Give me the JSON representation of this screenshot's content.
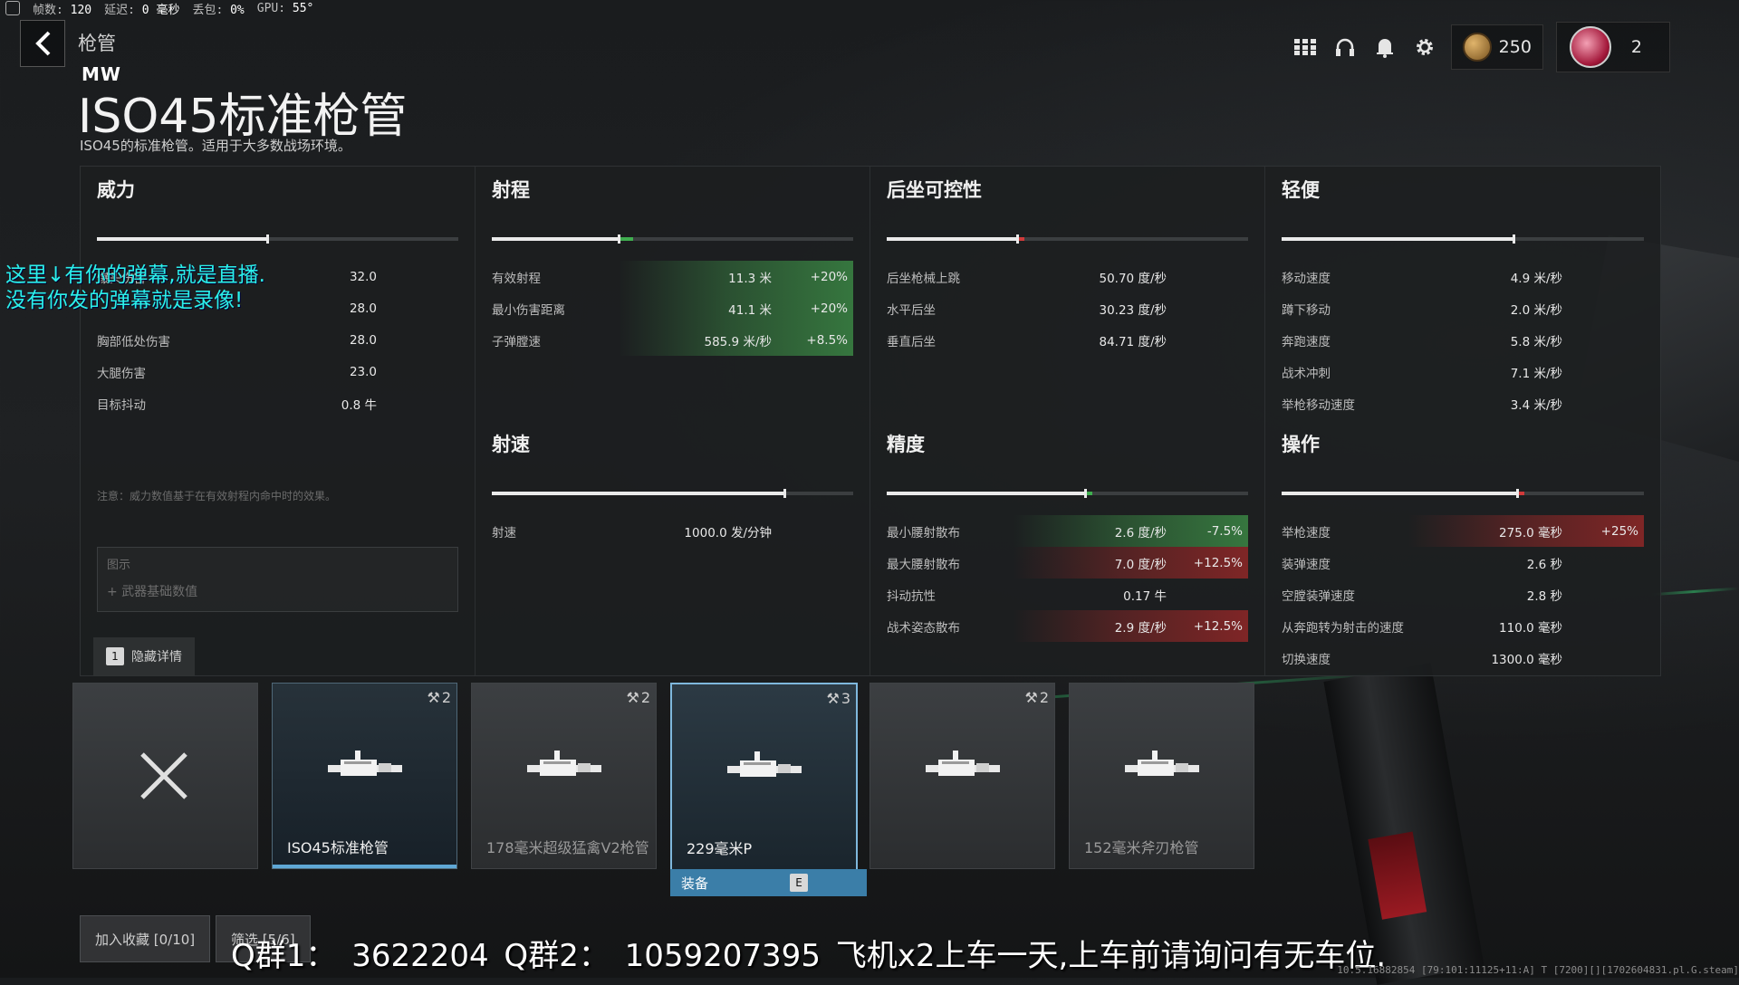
{
  "status": {
    "fps_label": "帧数:",
    "fps": "120",
    "latency_label": "延迟:",
    "latency": "0 毫秒",
    "loss_label": "丢包:",
    "loss": "0%",
    "gpu_label": "GPU:",
    "gpu": "55°"
  },
  "header": {
    "breadcrumb": "枪管",
    "brand": "MW",
    "title": "ISO45标准枪管",
    "subtitle": "ISO45的标准枪管。适用于大多数战场环境。"
  },
  "topbar": {
    "currency": "250",
    "profile_count": "2",
    "icons": [
      "grid-icon",
      "headset-icon",
      "bell-icon",
      "gear-icon"
    ]
  },
  "stats": {
    "power": {
      "title": "威力",
      "bar_fill": 0.47,
      "rows": [
        {
          "label": "爆头伤害",
          "value": "32.0"
        },
        {
          "label": "",
          "value": "28.0"
        },
        {
          "label": "胸部低处伤害",
          "value": "28.0"
        },
        {
          "label": "大腿伤害",
          "value": "23.0"
        },
        {
          "label": "目标抖动",
          "value": "0.8 牛"
        }
      ],
      "note": "注意：威力数值基于在有效射程内命中时的效果。",
      "legend_title": "图示",
      "legend_item": "+   武器基础数值",
      "hide_key": "1",
      "hide_label": "隐藏详情"
    },
    "range": {
      "title": "射程",
      "bar_fill": 0.35,
      "bar_delta": 0.04,
      "delta_color": "#3fae4f",
      "rows": [
        {
          "label": "有效射程",
          "value": "11.3 米",
          "change": "+20%",
          "state": "good"
        },
        {
          "label": "最小伤害距离",
          "value": "41.1 米",
          "change": "+20%",
          "state": "good"
        },
        {
          "label": "子弹膛速",
          "value": "585.9 米/秒",
          "change": "+8.5%",
          "state": "good"
        }
      ]
    },
    "recoil": {
      "title": "后坐可控性",
      "bar_fill": 0.36,
      "bar_delta": 0.02,
      "delta_color": "#d03a3a",
      "rows": [
        {
          "label": "后坐枪械上跳",
          "value": "50.70 度/秒"
        },
        {
          "label": "水平后坐",
          "value": "30.23 度/秒"
        },
        {
          "label": "垂直后坐",
          "value": "84.71 度/秒"
        }
      ]
    },
    "mobility": {
      "title": "轻便",
      "bar_fill": 0.64,
      "rows": [
        {
          "label": "移动速度",
          "value": "4.9 米/秒"
        },
        {
          "label": "蹲下移动",
          "value": "2.0 米/秒"
        },
        {
          "label": "奔跑速度",
          "value": "5.8 米/秒"
        },
        {
          "label": "战术冲刺",
          "value": "7.1 米/秒"
        },
        {
          "label": "举枪移动速度",
          "value": "3.4 米/秒"
        }
      ]
    },
    "fire_rate": {
      "title": "射速",
      "bar_fill": 0.81,
      "rows": [
        {
          "label": "射速",
          "value": "1000.0 发/分钟"
        }
      ]
    },
    "accuracy": {
      "title": "精度",
      "bar_fill": 0.55,
      "bar_delta": 0.02,
      "delta_color": "#3fae4f",
      "rows": [
        {
          "label": "最小腰射散布",
          "value": "2.6 度/秒",
          "change": "-7.5%",
          "state": "good"
        },
        {
          "label": "最大腰射散布",
          "value": "7.0 度/秒",
          "change": "+12.5%",
          "state": "bad"
        },
        {
          "label": "抖动抗性",
          "value": "0.17 牛"
        },
        {
          "label": "战术姿态散布",
          "value": "2.9 度/秒",
          "change": "+12.5%",
          "state": "bad"
        }
      ]
    },
    "handling": {
      "title": "操作",
      "bar_fill": 0.65,
      "bar_delta": 0.02,
      "delta_color": "#d03a3a",
      "rows": [
        {
          "label": "举枪速度",
          "value": "275.0 毫秒",
          "change": "+25%",
          "state": "bad"
        },
        {
          "label": "装弹速度",
          "value": "2.6 秒"
        },
        {
          "label": "空膛装弹速度",
          "value": "2.8 秒"
        },
        {
          "label": "从奔跑转为射击的速度",
          "value": "110.0 毫秒"
        },
        {
          "label": "切换速度",
          "value": "1300.0 毫秒"
        }
      ]
    }
  },
  "overlay_text": {
    "line1": "这里↓有你的弹幕,就是直播.",
    "line2": "没有你发的弹幕就是录像!"
  },
  "cards": [
    {
      "name": "",
      "count": "",
      "state": "empty"
    },
    {
      "name": "ISO45标准枪管",
      "count": "2",
      "state": "selected"
    },
    {
      "name": "178毫米超级猛禽V2枪管",
      "count": "2",
      "state": "normal"
    },
    {
      "name": "229毫米P",
      "count": "3",
      "state": "hover"
    },
    {
      "name": "",
      "count": "2",
      "state": "normal"
    },
    {
      "name": "152毫米斧刃枪管",
      "count": "",
      "state": "normal"
    }
  ],
  "equip_bar": {
    "label": "装备",
    "secondary": ""
  },
  "buttons": {
    "favorite": "加入收藏 [0/10]",
    "filter": "筛选 [5/6]"
  },
  "bottom_overlay": "Q群1： 3622204    Q群2： 1059207395     飞机x2上车一天,上车前请询问有无车位.",
  "build": "10.5.16882854 [79:101:11125+11:A] T [7200][][1702604831.pl.G.steam]"
}
